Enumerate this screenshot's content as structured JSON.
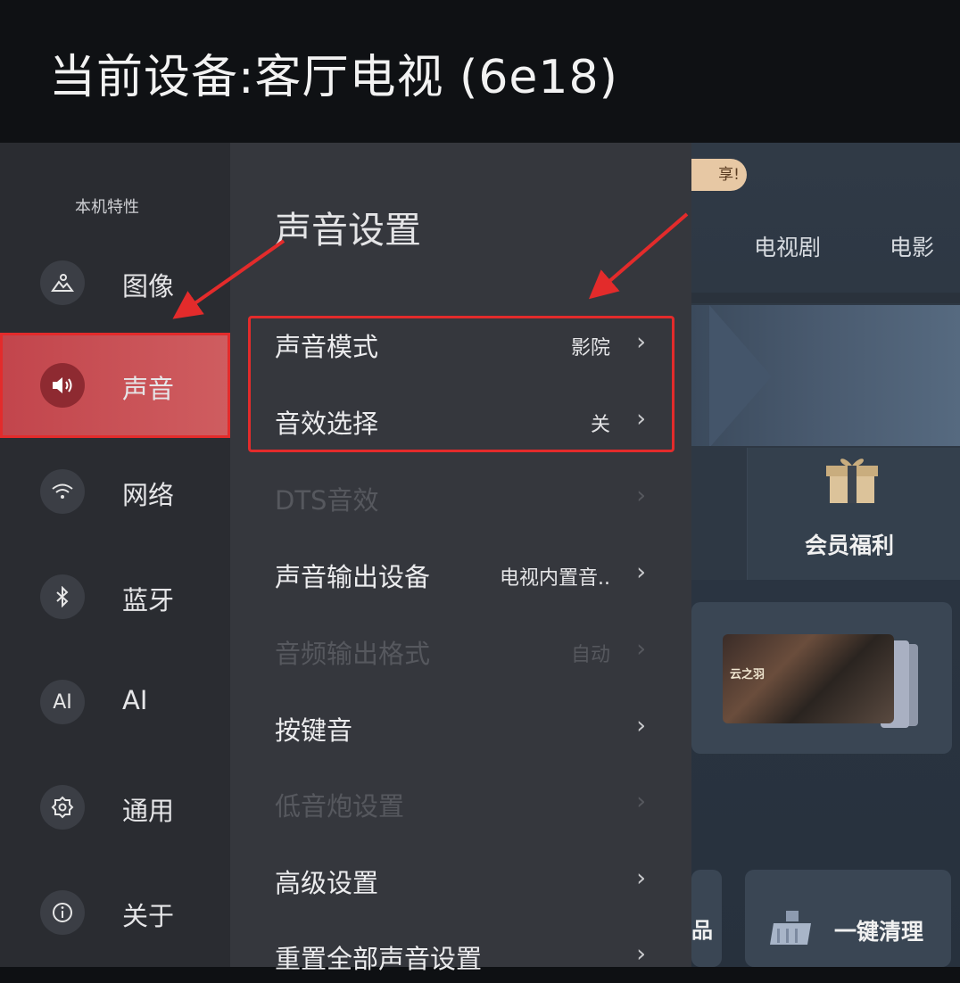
{
  "header": {
    "title": "当前设备:客厅电视 (6e18)"
  },
  "sidebar": {
    "heading": "本机特性",
    "items": [
      {
        "label": "图像",
        "icon": "image-icon"
      },
      {
        "label": "声音",
        "icon": "speaker-icon",
        "active": true
      },
      {
        "label": "网络",
        "icon": "wifi-icon"
      },
      {
        "label": "蓝牙",
        "icon": "bluetooth-icon"
      },
      {
        "label": "AI",
        "icon": "ai-icon",
        "icon_text": "AI"
      },
      {
        "label": "通用",
        "icon": "gear-icon"
      },
      {
        "label": "关于",
        "icon": "info-icon"
      }
    ]
  },
  "panel": {
    "title": "声音设置",
    "rows": [
      {
        "label": "声音模式",
        "value": "影院",
        "enabled": true
      },
      {
        "label": "音效选择",
        "value": "关",
        "enabled": true
      },
      {
        "label": "DTS音效",
        "value": "",
        "enabled": false
      },
      {
        "label": "声音输出设备",
        "value": "电视内置音..",
        "enabled": true
      },
      {
        "label": "音频输出格式",
        "value": "自动",
        "enabled": false
      },
      {
        "label": "按键音",
        "value": "",
        "enabled": true
      },
      {
        "label": "低音炮设置",
        "value": "",
        "enabled": false
      },
      {
        "label": "高级设置",
        "value": "",
        "enabled": true
      },
      {
        "label": "重置全部声音设置",
        "value": "",
        "enabled": true
      }
    ],
    "chevron": "›"
  },
  "background": {
    "promo": "享!",
    "tabs": [
      "电视剧",
      "电影"
    ],
    "card_label": "会员福利",
    "thumbnail_text": "云之羽",
    "small_card_partial": "品",
    "clean_label": "一键清理"
  },
  "colors": {
    "accent_red": "#e32b2b",
    "active_item": "#cf5d60",
    "sidebar_bg": "#2a2c31",
    "panel_bg": "#35373d"
  }
}
